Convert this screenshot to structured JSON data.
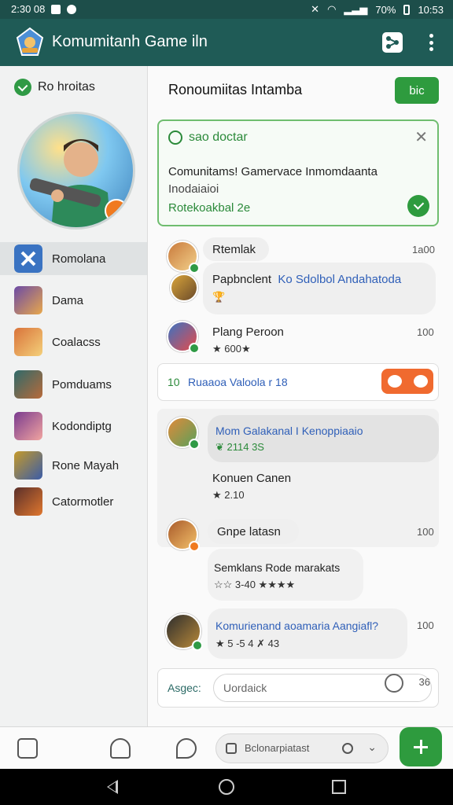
{
  "status_bar": {
    "time": "2:30 08",
    "battery": "70%",
    "clock": "10:53"
  },
  "app_bar": {
    "title": "Komumitanh Game iln",
    "logo_icon": "game-logo-icon",
    "action_icon": "share-icon",
    "more_icon": "more-vert-icon"
  },
  "sidebar": {
    "header": "Ro hroitas",
    "items": [
      {
        "label": "Romolana",
        "icon": "compass-icon"
      },
      {
        "label": "Dama",
        "icon": "game-thumb"
      },
      {
        "label": "Coalacss",
        "icon": "game-thumb"
      },
      {
        "label": "Pomduams",
        "icon": "game-thumb"
      },
      {
        "label": "Kodondiptg",
        "icon": "game-thumb"
      },
      {
        "label": "Rone Mayah",
        "icon": "game-thumb"
      },
      {
        "label": "Catormotler",
        "icon": "game-thumb"
      }
    ]
  },
  "main": {
    "title": "Ronoumiitas Intamba",
    "action_button": "bic",
    "notice": {
      "title": "sao doctar",
      "line1": "Comunitams! Gamervace Inmomdaanta",
      "line2": "Inodaiaioi",
      "link": "Rotekoakbal 2e"
    },
    "posts": [
      {
        "name": "Rtemlak",
        "time": "1a00",
        "text": "Papbnclent",
        "text_blue": "Ko Sdolbol Andahatoda",
        "meta": "🏆"
      },
      {
        "name": "Plang Peroon",
        "time": "100",
        "meta": "★ 600★"
      },
      {
        "name": "Mom Galakanal I Kenoppiaaio",
        "time": "",
        "meta": "❦ 2114  3S",
        "extra_name": "Konuen Canen",
        "extra_meta": "★ 2.10"
      },
      {
        "name": "Gnpe latasn",
        "time": "100",
        "text": "Semklans Rode marakats",
        "meta": "☆☆ 3-40  ★★★★"
      },
      {
        "name": "Komurienand aoamaria Aangiafl?",
        "time": "100",
        "meta": "★ 5 -5 4  ✗ 43"
      }
    ],
    "card_row": {
      "text": "Ruaaoa Valoola r 18",
      "prefix": "10"
    },
    "input": {
      "label": "Asgec:",
      "placeholder": "Uordaick",
      "count": "36"
    }
  },
  "bottom_nav": {
    "search_text": "Bclonarpiatast",
    "icons": [
      "clipboard-icon",
      "profile-icon",
      "pin-icon"
    ]
  },
  "colors": {
    "primary": "#1f5b56",
    "accent": "#2e9b3e",
    "orange": "#f06a2f",
    "link_blue": "#2f5fb8"
  }
}
